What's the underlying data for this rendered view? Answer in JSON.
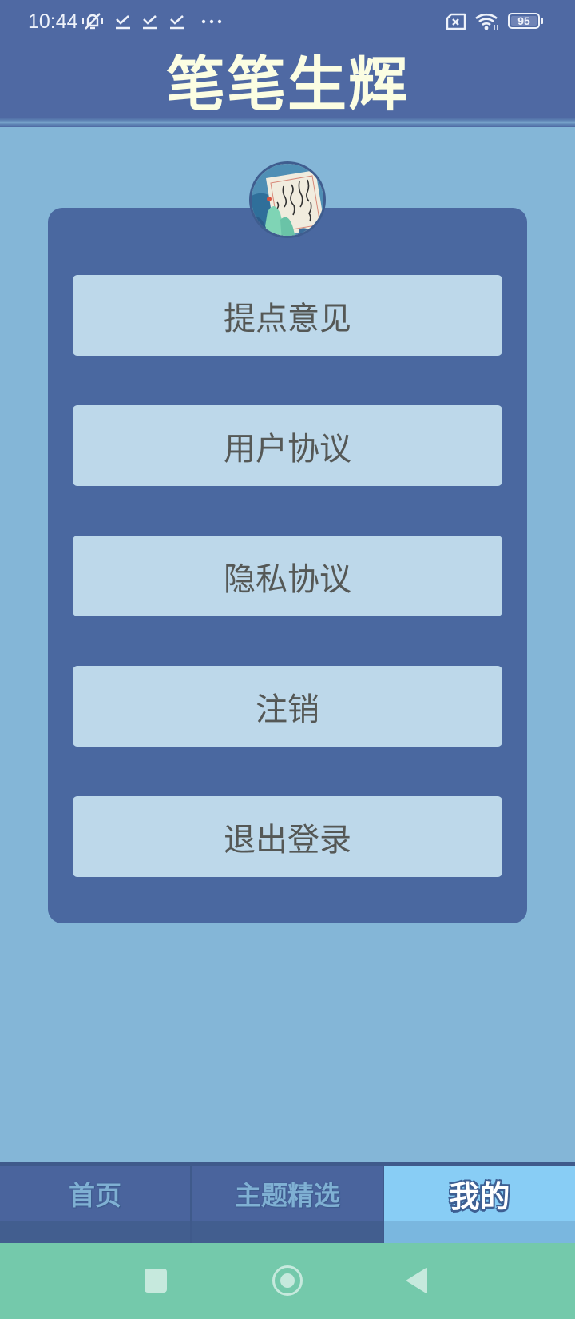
{
  "status_bar": {
    "time": "10:44",
    "left_icons": [
      "mute-notifications-icon",
      "download-done-icon",
      "download-done-icon",
      "download-done-icon",
      "more-dots-icon"
    ],
    "right_icons": [
      "no-sim-icon",
      "wifi-icon",
      "battery-icon"
    ],
    "battery_level": "95"
  },
  "header": {
    "title": "笔笔生辉"
  },
  "profile": {
    "avatar_icon": "calligraphy-avatar"
  },
  "menu": {
    "items": [
      {
        "label": "提点意见"
      },
      {
        "label": "用户协议"
      },
      {
        "label": "隐私协议"
      },
      {
        "label": "注销"
      },
      {
        "label": "退出登录"
      }
    ]
  },
  "tabbar": {
    "tabs": [
      {
        "label": "首页",
        "active": false
      },
      {
        "label": "主题精选",
        "active": false
      },
      {
        "label": "我的",
        "active": true
      }
    ]
  },
  "navbar": {
    "buttons": [
      "recents-icon",
      "home-icon",
      "back-icon"
    ]
  },
  "colors": {
    "header_bg": "#4f69a3",
    "page_bg": "#84b6d7",
    "card_bg": "#4a68a0",
    "button_bg": "#bdd8ea",
    "title_color": "#fbfde2",
    "tab_active_bg": "#88cdf5",
    "navbar_bg": "#74c9ab"
  }
}
